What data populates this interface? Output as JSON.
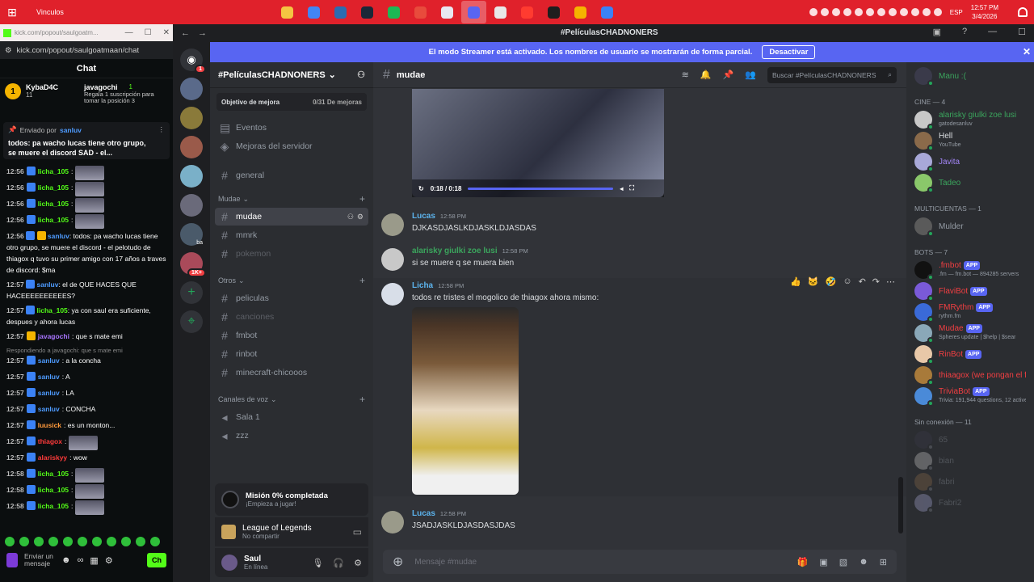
{
  "taskbar": {
    "window_title": "Vinculos",
    "lang": "ESP",
    "time": "12:57 PM",
    "date": "3/4/2026",
    "app_colors": [
      "#f4c542",
      "#4285f4",
      "#2b6cb0",
      "#1b2838",
      "#1db954",
      "#e84b3c",
      "#e8e8f0",
      "#5865f2",
      "#e8e8e8",
      "#ff3b30",
      "#1e1e1e",
      "#f5b400",
      "#3b82f6"
    ]
  },
  "kick": {
    "url_short": "kick.com/popout/saulgoatm...",
    "url": "kick.com/popout/saulgoatmaan/chat",
    "header": "Chat",
    "top": {
      "rank": "1",
      "user1": "KybaD4C",
      "user1_count": "11",
      "user2": "javagochi",
      "user2_count": "1",
      "gift_text": "Regala 1 suscripción para tomar la posición 3"
    },
    "pinned": {
      "label": "Enviado por",
      "user": "sanluv",
      "text": "todos: pa wacho lucas tiene otro grupo, se muere el discord SAD - el..."
    },
    "messages": [
      {
        "time": "12:56",
        "user": "licha_105",
        "color": "#53fc18",
        "text": ":",
        "emote": true
      },
      {
        "time": "12:56",
        "user": "licha_105",
        "color": "#53fc18",
        "text": ":",
        "emote": true
      },
      {
        "time": "12:56",
        "user": "licha_105",
        "color": "#53fc18",
        "text": ":",
        "emote": true
      },
      {
        "time": "12:56",
        "user": "licha_105",
        "color": "#53fc18",
        "text": ":",
        "emote": true
      }
    ],
    "long1": {
      "time": "12:56",
      "user": "sanluv",
      "text": ": todos: pa wacho lucas tiene otro grupo, se muere el discord",
      "text2": "- el pelotudo de thiagox q tuvo su primer amigo con 17 años a traves de discord: $ma"
    },
    "long2": {
      "time": "12:57",
      "user": "sanluv",
      "text": ": el de QUE HACES QUE HACEEEEEEEEEES?"
    },
    "long3": {
      "time": "12:57",
      "user": "licha_105",
      "text": ": ya con saul era suficiente, despues",
      "text2": "y ahora lucas"
    },
    "msg_java": {
      "time": "12:57",
      "user": "javagochi",
      "text": ": que s mate emi"
    },
    "reply_note": "Respondiendo a javagochi: que s mate emi",
    "messages2": [
      {
        "time": "12:57",
        "user": "sanluv",
        "color": "#4e9bff",
        "text": ": a la concha"
      },
      {
        "time": "12:57",
        "user": "sanluv",
        "color": "#4e9bff",
        "text": ": A"
      },
      {
        "time": "12:57",
        "user": "sanluv",
        "color": "#4e9bff",
        "text": ": LA"
      },
      {
        "time": "12:57",
        "user": "sanluv",
        "color": "#4e9bff",
        "text": ": CONCHA"
      },
      {
        "time": "12:57",
        "user": "luusick",
        "color": "#ff9a3c",
        "text": ": es un monton..."
      },
      {
        "time": "12:57",
        "user": "thiagox",
        "color": "#ff3b3b",
        "text": ":"
      },
      {
        "time": "12:57",
        "user": "alariskyy",
        "color": "#ff3b3b",
        "text": ": wow"
      },
      {
        "time": "12:58",
        "user": "licha_105",
        "color": "#53fc18",
        "text": ":"
      },
      {
        "time": "12:58",
        "user": "licha_105",
        "color": "#53fc18",
        "text": ":"
      },
      {
        "time": "12:58",
        "user": "licha_105",
        "color": "#53fc18",
        "text": ":"
      }
    ],
    "input_label": "Enviar un mensaje",
    "chat_button": "Ch"
  },
  "discord": {
    "title": "#PelículasCHADNONERS",
    "banner_text": "El modo Streamer está activado. Los nombres de usuario se mostrarán de forma parcial.",
    "banner_button": "Desactivar",
    "server_name": "#PelículasCHADNONERS",
    "boost_label": "Objetivo de mejora",
    "boost_count": "0/31 De mejoras",
    "nav": [
      "Eventos",
      "Mejoras del servidor"
    ],
    "general": "general",
    "cat_mudae": "Mudae",
    "ch_mudae": "mudae",
    "ch_mmrk": "mmrk",
    "ch_pokemon": "pokemon",
    "cat_otros": "Otros",
    "ch_others": [
      "peliculas",
      "canciones",
      "fmbot",
      "rinbot",
      "minecraft-chicooos"
    ],
    "cat_voice": "Canales de voz",
    "voice": [
      "Sala 1",
      "zzz"
    ],
    "mission_title": "Misión 0% completada",
    "mission_sub": "¡Empieza a jugar!",
    "activity_title": "League of Legends",
    "activity_sub": "No compartir",
    "user_name": "Saul",
    "user_status": "En línea",
    "guild_ping": "1",
    "guild_badge": "1K+",
    "guild_ba": "ba",
    "channel": "mudae",
    "search": "Buscar #PelículasCHADNONERS",
    "video_time": "0:18 / 0:18",
    "msgs": [
      {
        "user": "Lucas",
        "color": "#5cb4ee",
        "time": "12:58 PM",
        "text": "DJKASDJASLKDJASKLDJASDAS"
      },
      {
        "user": "alarisky giulki zoe lusi",
        "color": "#3ba55d",
        "time": "12:58 PM",
        "text": "si se muere q se muera bien"
      },
      {
        "user": "Licha",
        "color": "#5cb4ee",
        "time": "12:58 PM",
        "text": "todos re tristes el mogolico de thiagox ahora mismo:"
      },
      {
        "user": "Lucas",
        "color": "#5cb4ee",
        "time": "12:58 PM",
        "text": "JSADJASKLDJASDASJDAS"
      }
    ],
    "composer_placeholder": "Mensaje #mudae",
    "members": {
      "top": {
        "name": "Manu :(",
        "color": "#3ba55d"
      },
      "cine_label": "CINE — 4",
      "cine": [
        {
          "name": "alarisky giulki zoe lusi",
          "sub": "gatodesanluv",
          "color": "#3ba55d"
        },
        {
          "name": "Hell",
          "sub": "YouTube",
          "color": "#dbdee1"
        },
        {
          "name": "Javita",
          "sub": "",
          "color": "#a385f7"
        },
        {
          "name": "Tadeo",
          "sub": "",
          "color": "#3ba55d"
        }
      ],
      "multi_label": "MULTICUENTAS — 1",
      "multi": [
        {
          "name": "Mulder",
          "sub": "",
          "color": "#949ba4"
        }
      ],
      "bots_label": "BOTS — 7",
      "bots": [
        {
          "name": ".fmbot",
          "sub": ".fm — fm.bot — 894285 servers",
          "color": "#f23f42"
        },
        {
          "name": "FlaviBot",
          "sub": "",
          "color": "#f23f42"
        },
        {
          "name": "FMRythm",
          "sub": "rythm.fm",
          "color": "#f23f42"
        },
        {
          "name": "Mudae",
          "sub": "Spheres update | $help | $sear",
          "color": "#f23f42"
        },
        {
          "name": "RinBot",
          "sub": "",
          "color": "#f23f42"
        },
        {
          "name": "thiaagox (we pongan el fi",
          "sub": "",
          "color": "#f23f42"
        },
        {
          "name": "TriviaBot",
          "sub": "Trivia: 191,944 questions, 12 active",
          "color": "#f23f42"
        }
      ],
      "app_tag": "APP",
      "offline_label": "Sin conexión — 11",
      "offline": [
        {
          "name": "65"
        },
        {
          "name": "bian"
        },
        {
          "name": "fabri"
        },
        {
          "name": "Fabri2"
        }
      ]
    }
  }
}
